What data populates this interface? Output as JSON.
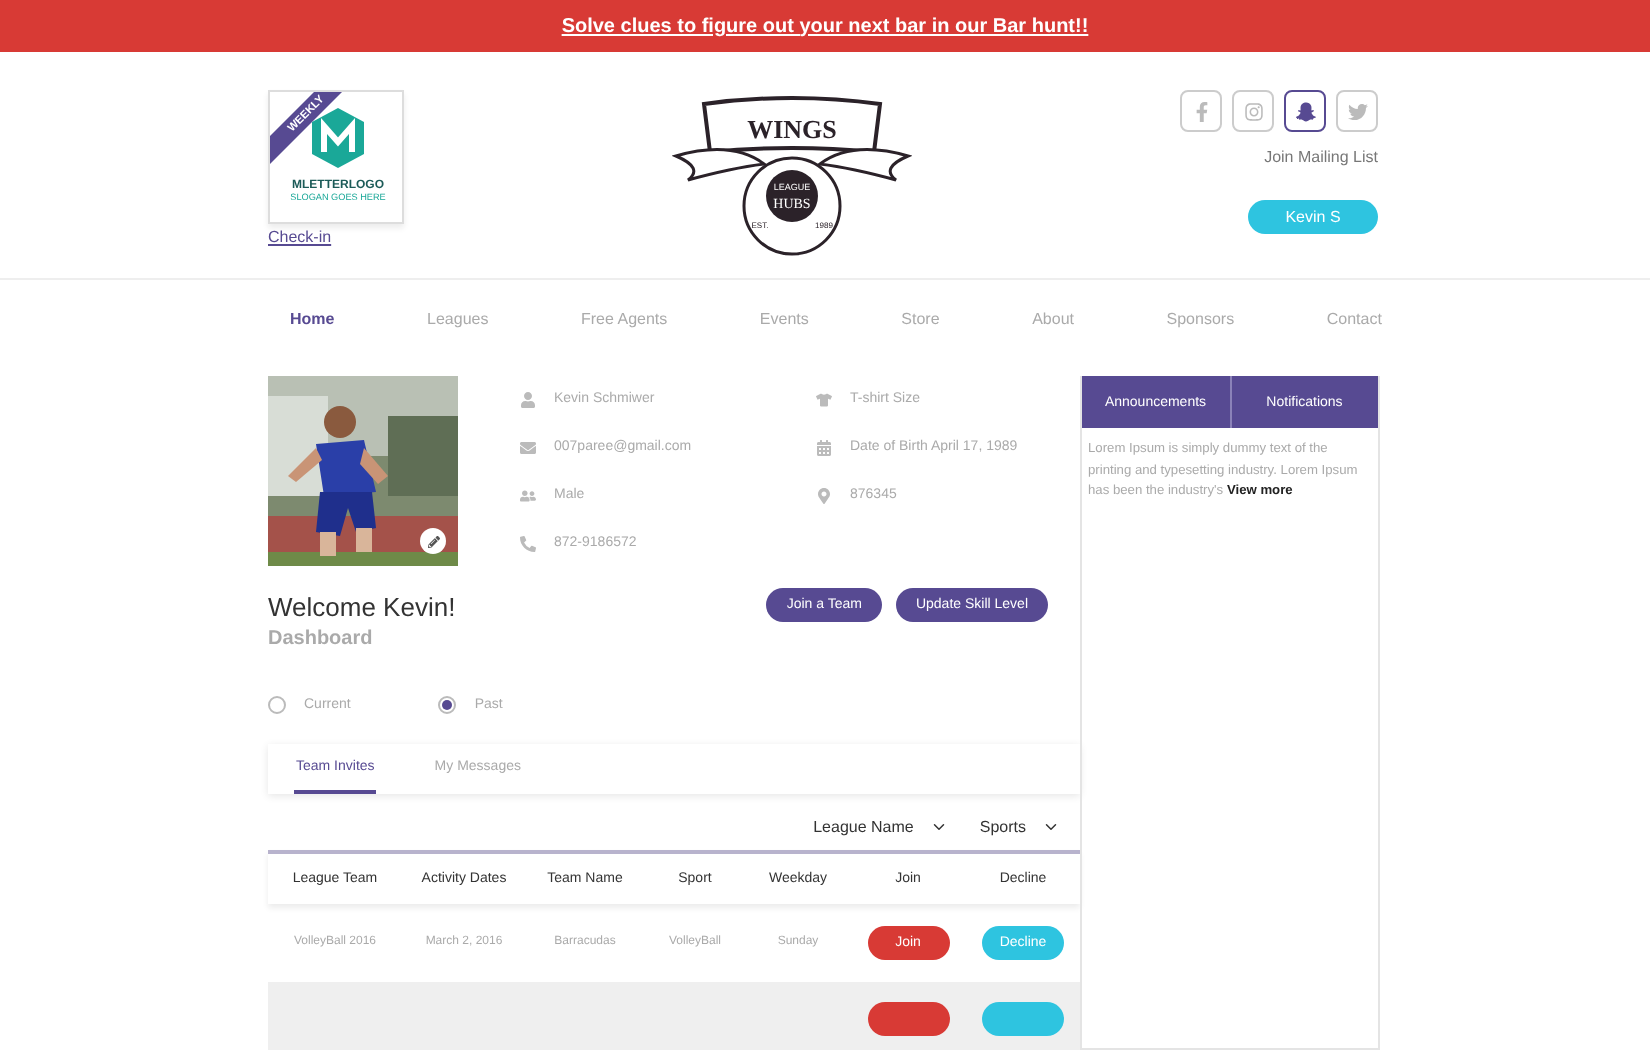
{
  "promo_bar": {
    "link": "Solve clues to figure out your next bar in our Bar hunt!!"
  },
  "badge": {
    "ribbon": "WEEKLY",
    "brand": "MLETTERLOGO",
    "slogan": "SLOGAN GOES HERE",
    "link": "Check-in"
  },
  "logo": {
    "title": "WINGS",
    "line1": "LEAGUE",
    "line2": "HUBS",
    "est": "EST.",
    "year": "1989"
  },
  "social": [
    {
      "kind": "facebook",
      "selected": false
    },
    {
      "kind": "instagram",
      "selected": false
    },
    {
      "kind": "snapchat",
      "selected": true
    },
    {
      "kind": "twitter",
      "selected": false
    }
  ],
  "mailing_link": "Join Mailing List",
  "user_button": "Kevin S",
  "nav": [
    {
      "label": "Home",
      "selected": true
    },
    {
      "label": "Leagues",
      "selected": false
    },
    {
      "label": "Free Agents",
      "selected": false
    },
    {
      "label": "Events",
      "selected": false
    },
    {
      "label": "Store",
      "selected": false
    },
    {
      "label": "About",
      "selected": false
    },
    {
      "label": "Sponsors",
      "selected": false
    },
    {
      "label": "Contact",
      "selected": false
    }
  ],
  "profile": {
    "info_left": [
      {
        "kind": "name",
        "text": "Kevin Schmiwer"
      },
      {
        "kind": "email",
        "text": "007paree@gmail.com"
      },
      {
        "kind": "gender",
        "text": "Male"
      },
      {
        "kind": "phone",
        "text": "872-9186572"
      }
    ],
    "info_right": [
      {
        "kind": "shirt",
        "text": "T-shirt Size"
      },
      {
        "kind": "birthday",
        "text": "Date of Birth April 17, 1989"
      },
      {
        "kind": "location",
        "text": "876345"
      }
    ],
    "welcome": "Welcome Kevin!",
    "subtitle": "Dashboard",
    "actions": [
      "Join a Team",
      "Update Skill Level"
    ]
  },
  "period": [
    {
      "label": "Current",
      "selected": false
    },
    {
      "label": "Past",
      "selected": true
    }
  ],
  "tabs": [
    {
      "label": "Team Invites",
      "selected": true
    },
    {
      "label": "My Messages",
      "selected": false
    }
  ],
  "filters": [
    "League Name",
    "Sports"
  ],
  "table": {
    "columns": [
      "League Team",
      "Activity Dates",
      "Team Name",
      "Sport",
      "Weekday",
      "Join",
      "Decline"
    ],
    "rows": [
      {
        "cells": [
          "VolleyBall 2016",
          "March 2, 2016",
          "Barracudas",
          "VolleyBall",
          "Sunday"
        ],
        "join": "Join",
        "decline": "Decline"
      }
    ],
    "partial_row": {
      "actions": [
        {
          "kind": "join"
        },
        {
          "kind": "decline"
        }
      ]
    }
  },
  "panel": {
    "tabs": [
      {
        "label": "Announcements",
        "selected": false
      },
      {
        "label": "Notifications",
        "selected": false
      }
    ],
    "text": "Lorem Ipsum is simply dummy text of the printing and typesetting industry. Lorem Ipsum has been the industry's",
    "more": "View more"
  }
}
